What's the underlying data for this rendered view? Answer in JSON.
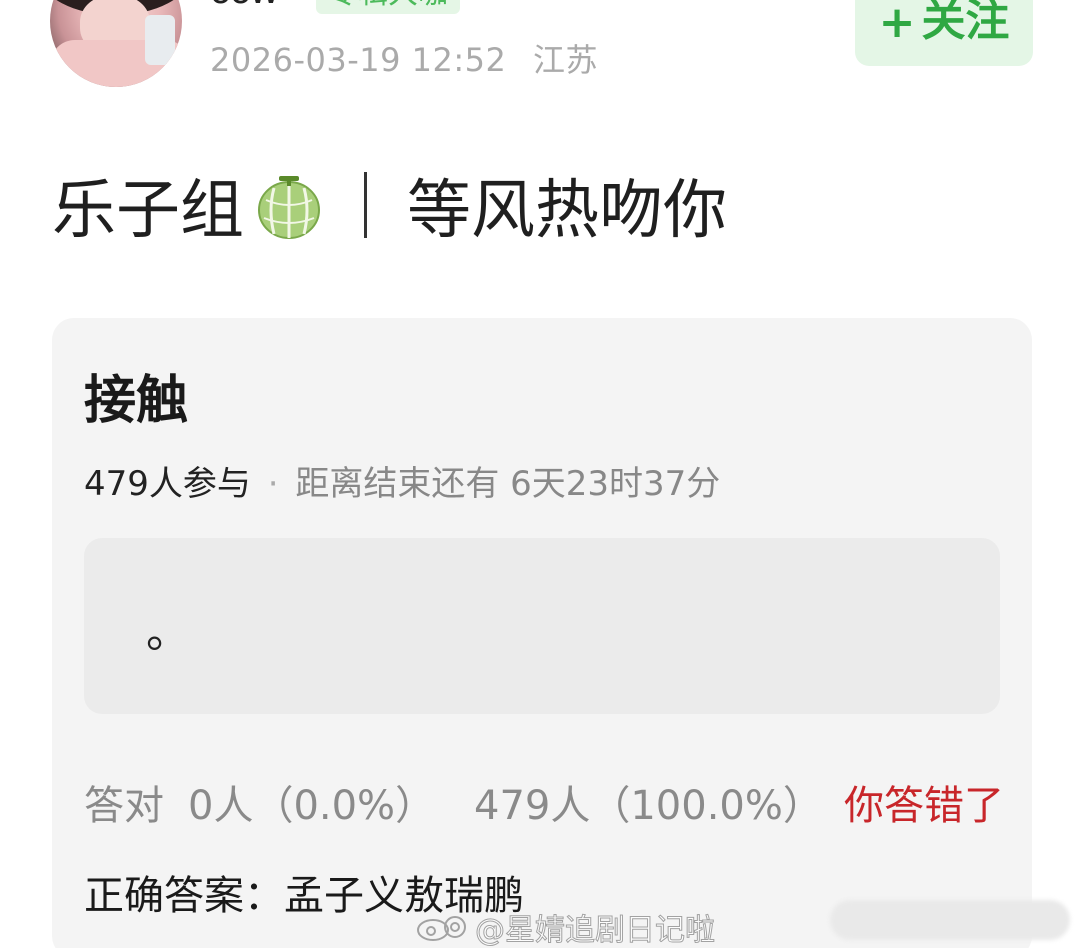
{
  "header": {
    "username": "ccw",
    "badge": "专辑大咖",
    "datetime": "2026-03-19 12:52",
    "location": "江苏",
    "follow_plus": "+",
    "follow_label": "关注"
  },
  "post": {
    "group": "乐子组",
    "group_icon": "melon-icon",
    "topic": "等风热吻你"
  },
  "quiz": {
    "title": "接触",
    "participants": "479人参与",
    "separator": "·",
    "remaining": "距离结束还有 6天23时37分",
    "answer_placeholder": "。",
    "correct_label": "答对",
    "correct_count": "0人（0.0%）",
    "wrong_count": "479人（100.0%）",
    "wrong_message": "你答错了",
    "correct_answer_label": "正确答案：",
    "correct_answer": "孟子义敖瑞鹏"
  },
  "watermark": {
    "text": "@星婧追剧日记啦"
  },
  "colors": {
    "accent_green": "#2fa843",
    "follow_bg": "#e4f6e6",
    "error_red": "#c8262a",
    "card_bg": "#f4f4f4"
  }
}
